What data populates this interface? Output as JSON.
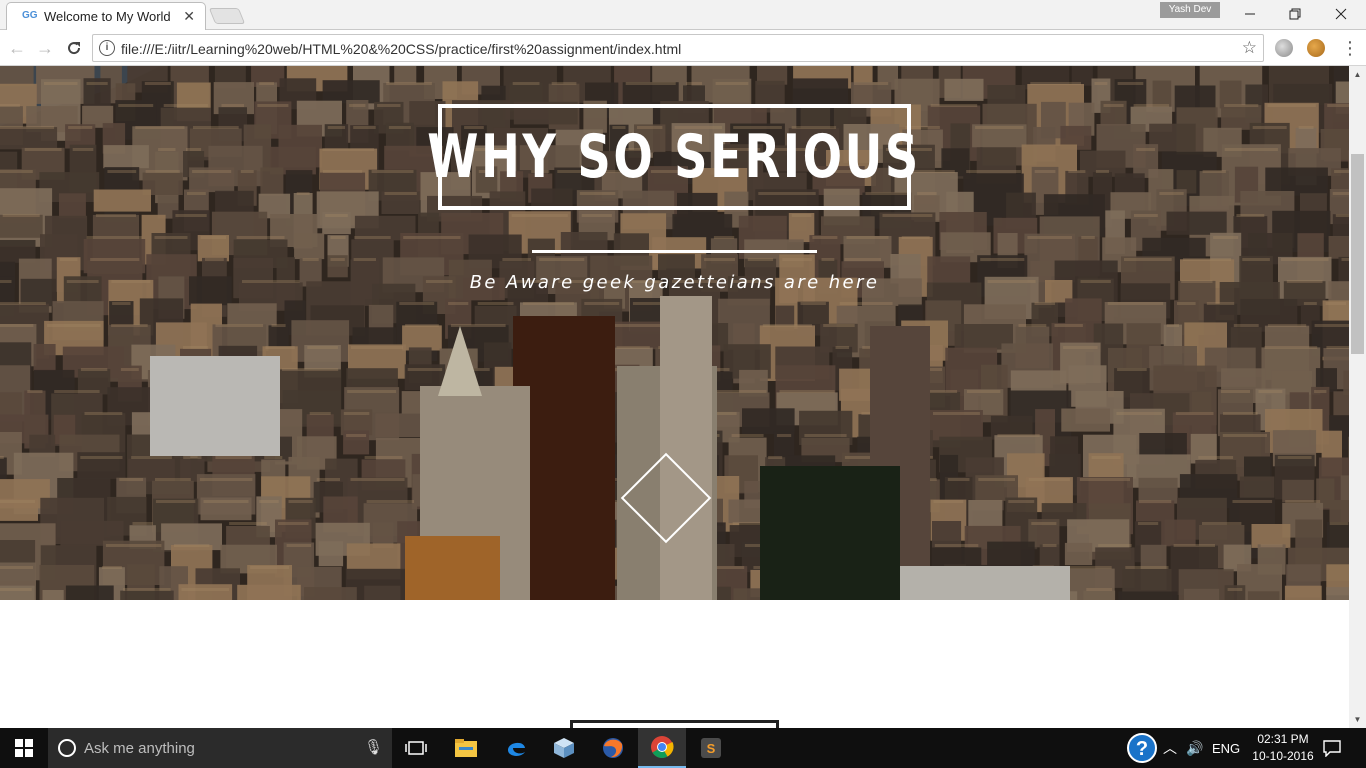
{
  "browser": {
    "tab_favicon": "GG",
    "tab_title": "Welcome to My World",
    "profile_name": "Yash Dev",
    "url": "file:///E:/iitr/Learning%20web/HTML%20&%20CSS/practice/first%20assignment/index.html",
    "icons": {
      "back": "arrow-left-icon",
      "forward": "arrow-right-icon",
      "reload": "reload-icon",
      "info": "info-icon",
      "bookmark": "star-icon",
      "menu": "kebab-menu-icon"
    }
  },
  "page": {
    "hero_title": "WHY SO SERIOUS",
    "hero_tagline": "Be Aware geek gazetteians are here"
  },
  "taskbar": {
    "search_placeholder": "Ask me anything",
    "language": "ENG",
    "time": "02:31 PM",
    "date": "10-10-2016",
    "apps": [
      "task-view",
      "file-explorer",
      "edge",
      "box-app",
      "firefox",
      "chrome",
      "sublime-text"
    ],
    "active_app": "chrome",
    "accent_color": "#76b9ed"
  }
}
